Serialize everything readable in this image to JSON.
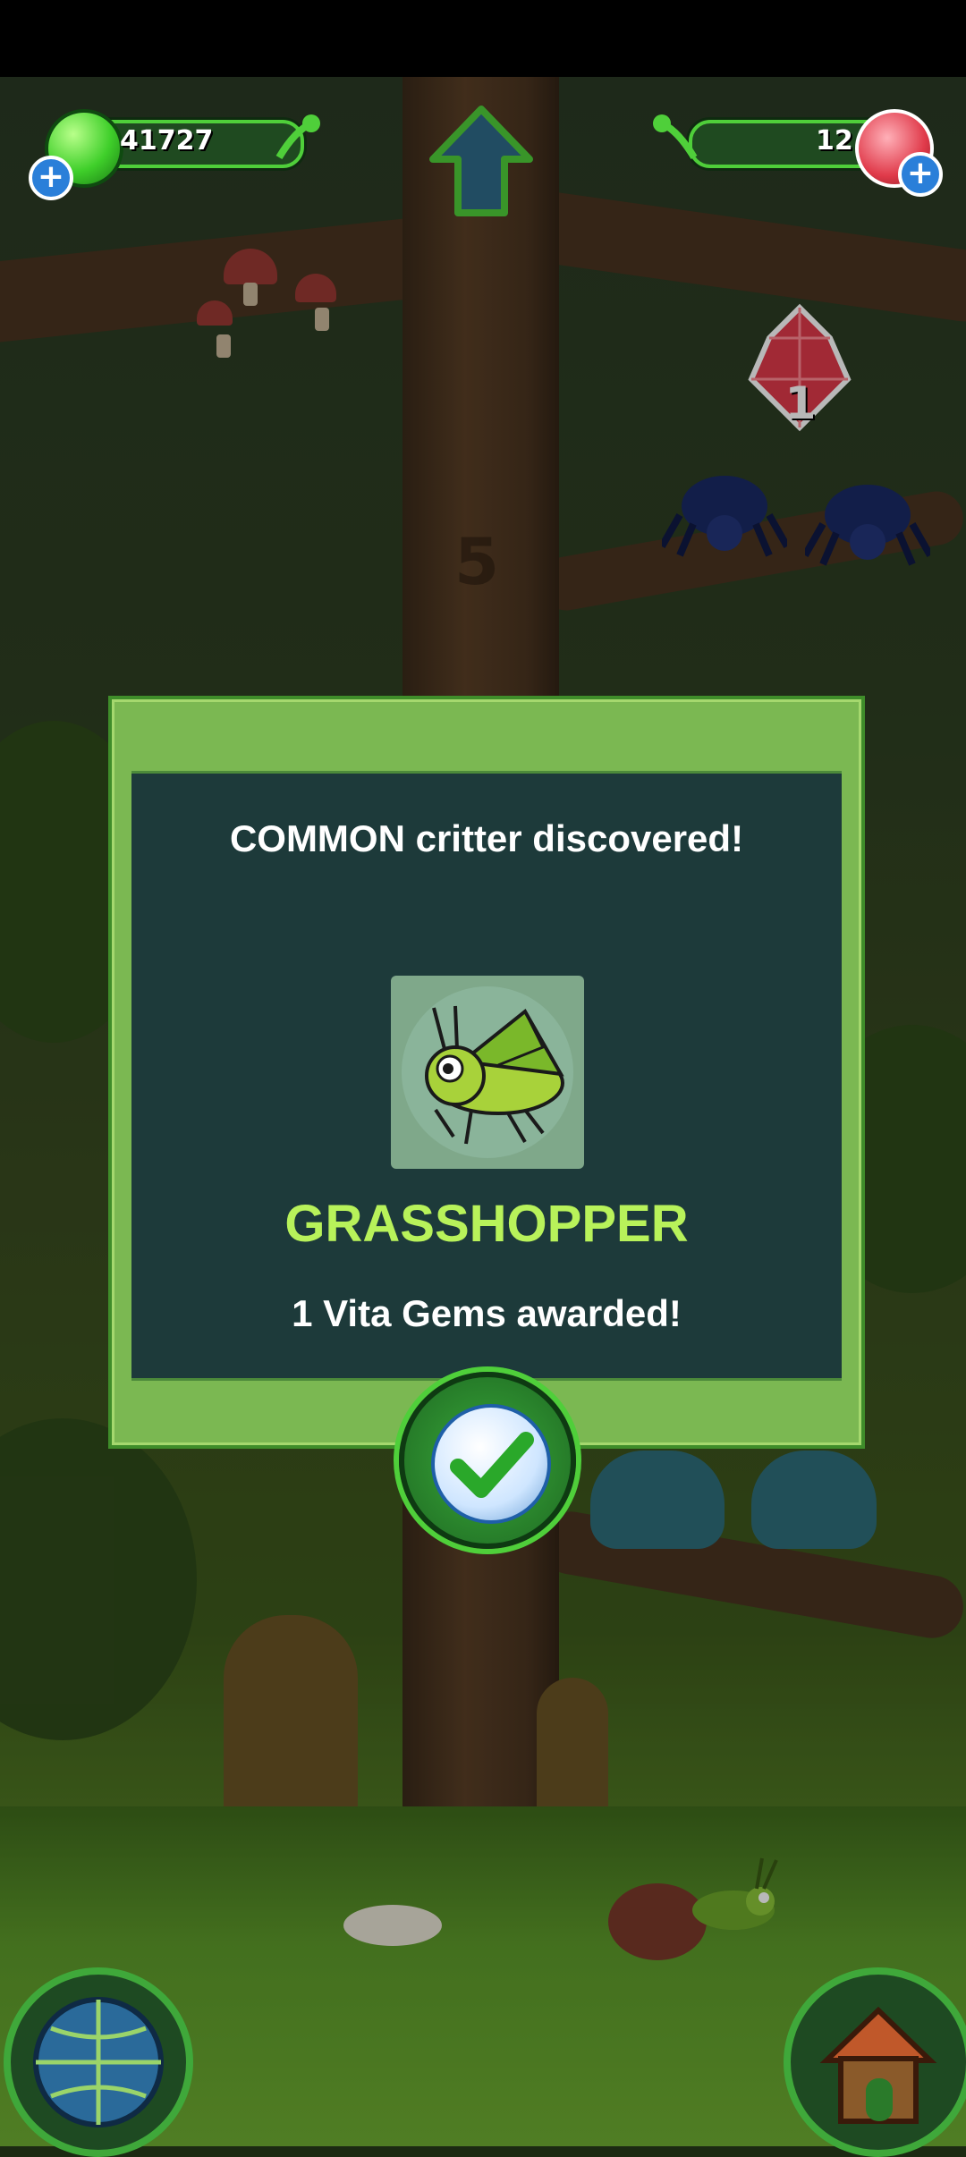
{
  "hud": {
    "vita_count": "41727",
    "gem_count": "12",
    "floating_gem_reward": "1"
  },
  "scene": {
    "tree_level_marker": "5"
  },
  "modal": {
    "title": "COMMON critter discovered!",
    "critter_name": "GRASSHOPPER",
    "award_text": "1 Vita Gems awarded!"
  },
  "colors": {
    "accent_green": "#4fcf3a",
    "critter_name": "#b8f25a",
    "panel": "#1d3a3a",
    "frame": "#7bb852"
  },
  "icons": [
    "vita-orb-icon",
    "gem-icon",
    "plus-icon",
    "up-arrow-icon",
    "checkmark-icon",
    "globe-icon",
    "treehouse-icon"
  ]
}
